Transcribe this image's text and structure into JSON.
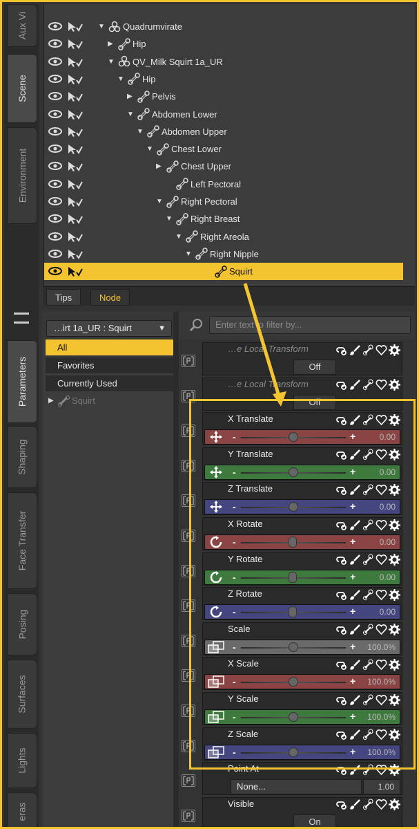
{
  "left_tabs": {
    "top": [
      "Aux Vi",
      "Scene",
      "Environment"
    ],
    "bottom": [
      "Parameters",
      "Shaping",
      "Face Transfer",
      "Posing",
      "Surfaces",
      "Lights",
      "eras"
    ]
  },
  "scene": {
    "rows": [
      {
        "label": "Quadrumvirate",
        "icon": "figure"
      },
      {
        "label": "Hip",
        "icon": "bone"
      },
      {
        "label": "QV_Milk Squirt 1a_UR",
        "icon": "figure"
      },
      {
        "label": "Hip",
        "icon": "bone"
      },
      {
        "label": "Pelvis",
        "icon": "bone"
      },
      {
        "label": "Abdomen Lower",
        "icon": "bone"
      },
      {
        "label": "Abdomen Upper",
        "icon": "bone"
      },
      {
        "label": "Chest Lower",
        "icon": "bone"
      },
      {
        "label": "Chest Upper",
        "icon": "bone"
      },
      {
        "label": "Left Pectoral",
        "icon": "bone"
      },
      {
        "label": "Right Pectoral",
        "icon": "bone"
      },
      {
        "label": "Right Breast",
        "icon": "bone"
      },
      {
        "label": "Right Areola",
        "icon": "bone"
      },
      {
        "label": "Right Nipple",
        "icon": "bone"
      },
      {
        "label": "Squirt",
        "icon": "bone",
        "selected": true
      }
    ]
  },
  "bottom_tabs": {
    "tips": "Tips",
    "node": "Node"
  },
  "params": {
    "node_select": "…irt 1a_UR : Squirt",
    "filter_placeholder": "Enter text to filter by...",
    "categories": [
      "All",
      "Favorites",
      "Currently Used"
    ],
    "tree_node": "Squirt",
    "rows": [
      {
        "name": "…e Local Transform",
        "kind": "button",
        "value": "Off",
        "color": "#2a2a2a"
      },
      {
        "name": "…e Local Transform",
        "kind": "button",
        "value": "Off",
        "color": "#2a2a2a"
      },
      {
        "name": "X Translate",
        "kind": "slider",
        "value": "0.00",
        "position": 0.5,
        "color": "#8a4444",
        "icon": "move"
      },
      {
        "name": "Y Translate",
        "kind": "slider",
        "value": "0.00",
        "position": 0.5,
        "color": "#3e7a3e",
        "icon": "move"
      },
      {
        "name": "Z Translate",
        "kind": "slider",
        "value": "0.00",
        "position": 0.5,
        "color": "#45457f",
        "icon": "move"
      },
      {
        "name": "X Rotate",
        "kind": "slider",
        "value": "0.00",
        "position": 0.5,
        "color": "#8a4444",
        "icon": "rotate"
      },
      {
        "name": "Y Rotate",
        "kind": "slider",
        "value": "0.00",
        "position": 0.5,
        "color": "#3e7a3e",
        "icon": "rotate"
      },
      {
        "name": "Z Rotate",
        "kind": "slider",
        "value": "0.00",
        "position": 0.5,
        "color": "#45457f",
        "icon": "rotate"
      },
      {
        "name": "Scale",
        "kind": "slider",
        "value": "100.0%",
        "position": 0.5,
        "color": "#6a6a6a",
        "icon": "scale"
      },
      {
        "name": "X Scale",
        "kind": "slider",
        "value": "100.0%",
        "position": 0.5,
        "color": "#8a4444",
        "icon": "scale"
      },
      {
        "name": "Y Scale",
        "kind": "slider",
        "value": "100.0%",
        "position": 0.5,
        "color": "#3e7a3e",
        "icon": "scale"
      },
      {
        "name": "Z Scale",
        "kind": "slider",
        "value": "100.0%",
        "position": 0.5,
        "color": "#45457f",
        "icon": "scale"
      },
      {
        "name": "Point At",
        "kind": "pointat",
        "value": "None...",
        "number": "1.00",
        "color": "#2a2a2a"
      },
      {
        "name": "Visible",
        "kind": "button",
        "value": "On",
        "color": "#2a2a2a"
      }
    ]
  },
  "colors": {
    "accent": "#f4c430",
    "panel": "#3c3c3c"
  }
}
